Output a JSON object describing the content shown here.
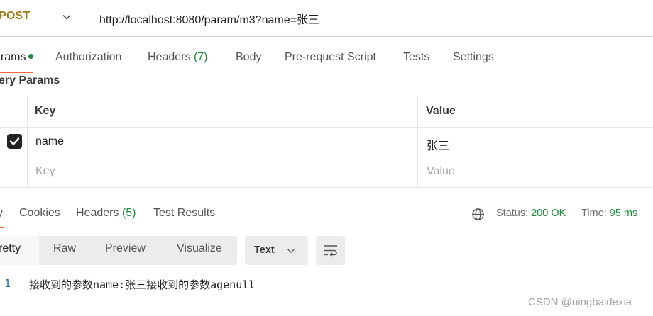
{
  "request": {
    "method": "POST",
    "url": "http://localhost:8080/param/m3?name=张三"
  },
  "request_tabs": [
    {
      "label": "arams",
      "active": true
    },
    {
      "label": "Authorization"
    },
    {
      "label": "Headers",
      "count": "(7)"
    },
    {
      "label": "Body"
    },
    {
      "label": "Pre-request Script"
    },
    {
      "label": "Tests"
    },
    {
      "label": "Settings"
    }
  ],
  "query_params": {
    "title": "ery Params",
    "headers": {
      "key": "Key",
      "value": "Value"
    },
    "rows": [
      {
        "key": "name",
        "value": "张三",
        "checked": true
      }
    ],
    "placeholder": {
      "key": "Key",
      "value": "Value"
    }
  },
  "response_tabs": [
    {
      "label": "y",
      "active": true
    },
    {
      "label": "Cookies"
    },
    {
      "label": "Headers",
      "count": "(5)"
    },
    {
      "label": "Test Results"
    }
  ],
  "response_status": {
    "status_label": "Status:",
    "status_value": "200 OK",
    "time_label": "Time:",
    "time_value": "95 ms"
  },
  "view_modes": [
    "retty",
    "Raw",
    "Preview",
    "Visualize"
  ],
  "format": "Text",
  "response_body": {
    "line_number": "1",
    "text": "接收到的参数name:张三接收到的参数agenull"
  },
  "watermark": "CSDN @ningbaidexia",
  "colors": {
    "method": "#9e7b1a",
    "accent": "#ff6c37",
    "success": "#1b8a3c",
    "line_number": "#1f6fb5"
  }
}
